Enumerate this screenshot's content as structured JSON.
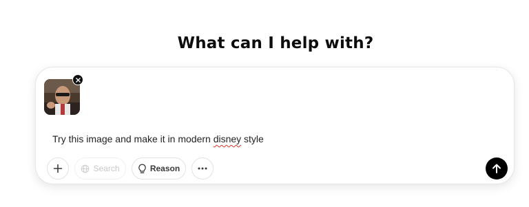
{
  "headline": "What can I help with?",
  "composer": {
    "attachment": {
      "kind": "image",
      "remove_icon": "close-icon"
    },
    "prompt_text_before": "Try this image and make it in modern ",
    "prompt_text_misspelled": "disney",
    "prompt_text_after": " style",
    "toolbar": {
      "add_icon": "plus-icon",
      "search_label": "Search",
      "search_icon": "globe-icon",
      "reason_label": "Reason",
      "reason_icon": "lightbulb-icon",
      "more_icon": "more-horizontal-icon",
      "send_icon": "arrow-up-icon"
    }
  }
}
